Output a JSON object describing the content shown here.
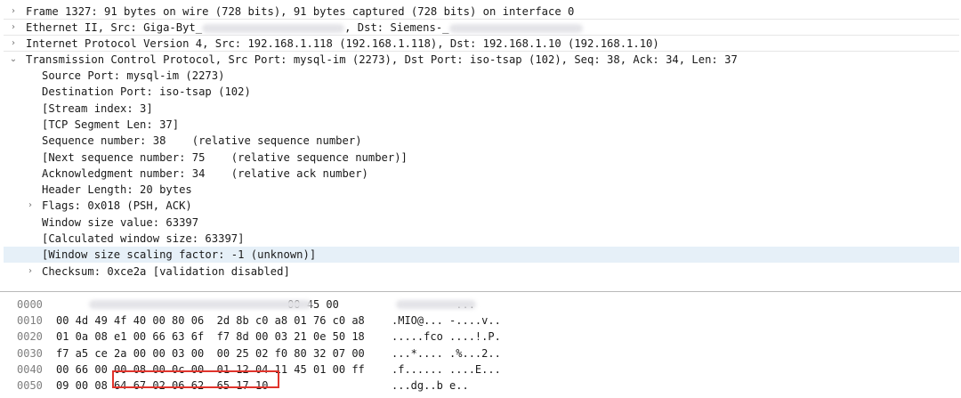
{
  "packet_details": {
    "frame": "Frame 1327: 91 bytes on wire (728 bits), 91 bytes captured (728 bits) on interface 0",
    "ethernet": {
      "prefix": "Ethernet II, Src: Giga-Byt_",
      "middle": ", Dst: Siemens-_"
    },
    "ip": "Internet Protocol Version 4, Src: 192.168.1.118 (192.168.1.118), Dst: 192.168.1.10 (192.168.1.10)",
    "tcp": "Transmission Control Protocol, Src Port: mysql-im (2273), Dst Port: iso-tsap (102), Seq: 38, Ack: 34, Len: 37",
    "tcp_fields": [
      {
        "text": "Source Port: mysql-im (2273)",
        "expandable": false,
        "selected": false
      },
      {
        "text": "Destination Port: iso-tsap (102)",
        "expandable": false,
        "selected": false
      },
      {
        "text": "[Stream index: 3]",
        "expandable": false,
        "selected": false
      },
      {
        "text": "[TCP Segment Len: 37]",
        "expandable": false,
        "selected": false
      },
      {
        "text": "Sequence number: 38    (relative sequence number)",
        "expandable": false,
        "selected": false
      },
      {
        "text": "[Next sequence number: 75    (relative sequence number)]",
        "expandable": false,
        "selected": false
      },
      {
        "text": "Acknowledgment number: 34    (relative ack number)",
        "expandable": false,
        "selected": false
      },
      {
        "text": "Header Length: 20 bytes",
        "expandable": false,
        "selected": false
      },
      {
        "text": "Flags: 0x018 (PSH, ACK)",
        "expandable": true,
        "selected": false
      },
      {
        "text": "Window size value: 63397",
        "expandable": false,
        "selected": false
      },
      {
        "text": "[Calculated window size: 63397]",
        "expandable": false,
        "selected": false
      },
      {
        "text": "[Window size scaling factor: -1 (unknown)]",
        "expandable": false,
        "selected": true
      },
      {
        "text": "Checksum: 0xce2a [validation disabled]",
        "expandable": true,
        "selected": false
      }
    ]
  },
  "hex_dump": {
    "rows": [
      {
        "offset": "0000",
        "bytes": "                                    00 45 00",
        "ascii": "          ..."
      },
      {
        "offset": "0010",
        "bytes": "00 4d 49 4f 40 00 80 06  2d 8b c0 a8 01 76 c0 a8",
        "ascii": ".MIO@... -....v.."
      },
      {
        "offset": "0020",
        "bytes": "01 0a 08 e1 00 66 63 6f  f7 8d 00 03 21 0e 50 18",
        "ascii": ".....fco ....!.P."
      },
      {
        "offset": "0030",
        "bytes": "f7 a5 ce 2a 00 00 03 00  00 25 02 f0 80 32 07 00",
        "ascii": "...*.... .%...2.."
      },
      {
        "offset": "0040",
        "bytes": "00 66 00 00 08 00 0c 00  01 12 04 11 45 01 00 ff",
        "ascii": ".f...... ....E..."
      },
      {
        "offset": "0050",
        "bytes": "09 00 08 64 67 02 06 62  65 17 10",
        "ascii": "...dg..b e.."
      }
    ]
  },
  "colors": {
    "selected_row": "#e6f0f8",
    "highlight_box": "#e0342c"
  }
}
